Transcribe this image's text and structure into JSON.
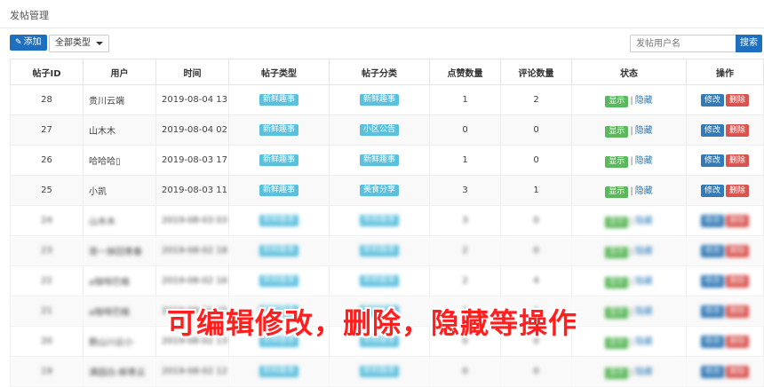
{
  "page": {
    "title": "发帖管理"
  },
  "toolbar": {
    "add_label": "添加",
    "type_filter": "全部类型",
    "search_placeholder": "发帖用户名",
    "search_label": "搜索"
  },
  "table": {
    "headers": [
      "帖子ID",
      "用户",
      "时间",
      "帖子类型",
      "帖子分类",
      "点赞数量",
      "评论数量",
      "状态",
      "操作"
    ],
    "rows": [
      {
        "id": "28",
        "user": "贵川云端",
        "time": "2019-08-04 13:...",
        "type": "新鲜趣事",
        "category": "新鲜趣事",
        "likes": "1",
        "comments": "2"
      },
      {
        "id": "27",
        "user": "山木木",
        "time": "2019-08-04 02:...",
        "type": "新鲜趣事",
        "category": "小区公告",
        "likes": "0",
        "comments": "0"
      },
      {
        "id": "26",
        "user": "哈哈哈▯",
        "time": "2019-08-03 17:...",
        "type": "新鲜趣事",
        "category": "新鲜趣事",
        "likes": "1",
        "comments": "0"
      },
      {
        "id": "25",
        "user": "小凯",
        "time": "2019-08-03 11:...",
        "type": "新鲜趣事",
        "category": "美食分享",
        "likes": "3",
        "comments": "1"
      },
      {
        "id": "24",
        "user": "山木木",
        "time": "2019-08-03 03:...",
        "type": "新鲜趣事",
        "category": "新鲜趣事",
        "likes": "3",
        "comments": "0"
      },
      {
        "id": "23",
        "user": "哥一抹回青春",
        "time": "2019-08-02 18:...",
        "type": "新鲜趣事",
        "category": "新鲜趣事",
        "likes": "2",
        "comments": "0"
      },
      {
        "id": "22",
        "user": "a咖啡巴格",
        "time": "2019-08-02 16:...",
        "type": "新鲜趣事",
        "category": "新鲜趣事",
        "likes": "2",
        "comments": "4"
      },
      {
        "id": "21",
        "user": "a咖啡巴格",
        "time": "2019-08-02 15:...",
        "type": "新鲜趣事",
        "category": "新鲜趣事",
        "likes": "2",
        "comments": "1"
      },
      {
        "id": "20",
        "user": "鹅山川云小",
        "time": "2019-08-02 13:...",
        "type": "新鲜趣事",
        "category": "新鲜趣事",
        "likes": "0",
        "comments": "0"
      },
      {
        "id": "19",
        "user": "满园白-柳青云",
        "time": "2019-08-02 12:...",
        "type": "新鲜趣事",
        "category": "新鲜趣事",
        "likes": "0",
        "comments": "0"
      }
    ],
    "status_show": "显示",
    "status_hide": "隐藏",
    "edit_label": "修改",
    "delete_label": "删除"
  },
  "overlay": {
    "caption": "可编辑修改，删除，隐藏等操作"
  },
  "colors": {
    "primary": "#1f6fbf",
    "tag": "#5bc0de",
    "show": "#5cb85c",
    "delete": "#d9534f",
    "caption": "#ff1f1f"
  }
}
